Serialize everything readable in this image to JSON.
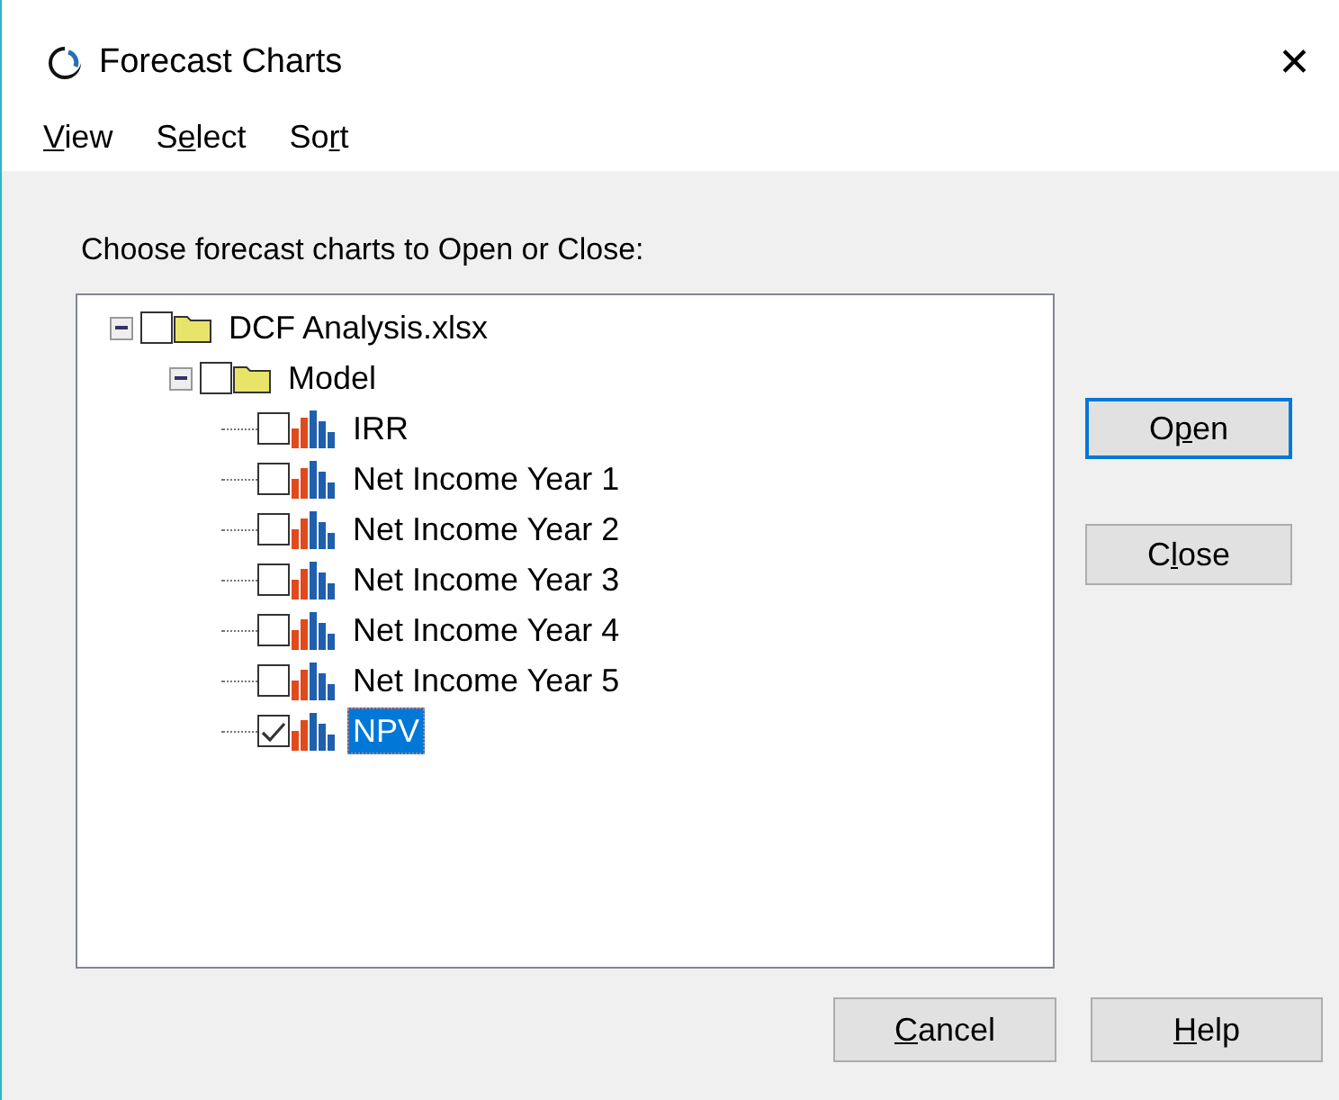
{
  "window": {
    "title": "Forecast Charts",
    "close": "✕"
  },
  "menu": [
    {
      "key": "V",
      "post": "iew"
    },
    {
      "pre": "S",
      "key": "e",
      "post": "lect"
    },
    {
      "pre": "So",
      "key": "r",
      "post": "t"
    }
  ],
  "prompt": "Choose forecast charts to Open or Close:",
  "tree": [
    {
      "kind": "folder",
      "label": "DCF Analysis.xlsx",
      "expanded": true,
      "checked": false,
      "selected": false,
      "children": [
        {
          "kind": "folder",
          "label": "Model",
          "expanded": true,
          "checked": false,
          "selected": false,
          "children": [
            {
              "kind": "chart",
              "label": "IRR",
              "checked": false,
              "selected": false
            },
            {
              "kind": "chart",
              "label": "Net Income Year 1",
              "checked": false,
              "selected": false
            },
            {
              "kind": "chart",
              "label": "Net Income Year 2",
              "checked": false,
              "selected": false
            },
            {
              "kind": "chart",
              "label": "Net Income Year 3",
              "checked": false,
              "selected": false
            },
            {
              "kind": "chart",
              "label": "Net Income Year 4",
              "checked": false,
              "selected": false
            },
            {
              "kind": "chart",
              "label": "Net Income Year 5",
              "checked": false,
              "selected": false
            },
            {
              "kind": "chart",
              "label": "NPV",
              "checked": true,
              "selected": true
            }
          ]
        }
      ]
    }
  ],
  "side_buttons": [
    {
      "pre": "O",
      "key": "p",
      "post": "en",
      "default": true
    },
    {
      "pre": "C",
      "key": "l",
      "post": "ose",
      "default": false
    }
  ],
  "bottom_buttons": [
    {
      "key": "C",
      "post": "ancel",
      "default": false
    },
    {
      "key": "H",
      "post": "elp",
      "default": false
    }
  ]
}
